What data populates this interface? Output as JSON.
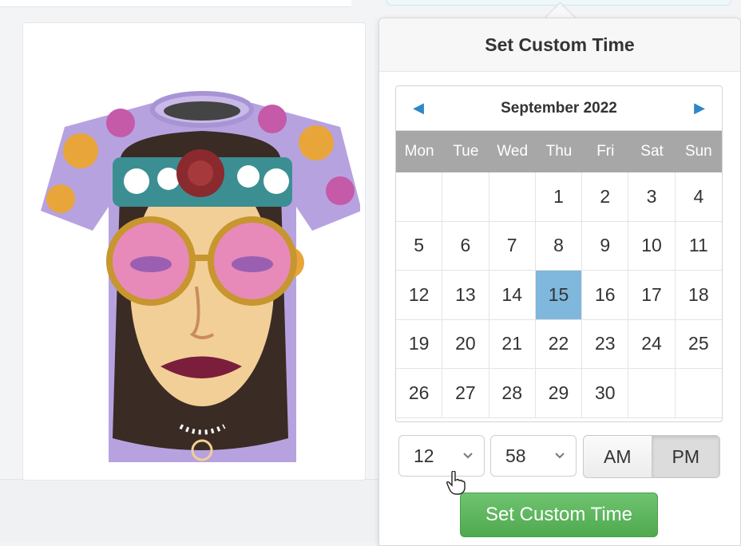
{
  "popover": {
    "title": "Set Custom Time"
  },
  "calendar": {
    "month_label": "September 2022",
    "prev_icon": "chevron-left-icon",
    "next_icon": "chevron-right-icon",
    "weekdays": [
      "Mon",
      "Tue",
      "Wed",
      "Thu",
      "Fri",
      "Sat",
      "Sun"
    ],
    "days": [
      "",
      "",
      "",
      "1",
      "2",
      "3",
      "4",
      "5",
      "6",
      "7",
      "8",
      "9",
      "10",
      "11",
      "12",
      "13",
      "14",
      "15",
      "16",
      "17",
      "18",
      "19",
      "20",
      "21",
      "22",
      "23",
      "24",
      "25",
      "26",
      "27",
      "28",
      "29",
      "30",
      "",
      ""
    ],
    "selected_day": "15",
    "selected_color": "#7fb7dd",
    "nav_color": "#2f86c9"
  },
  "time": {
    "hour": "12",
    "minute": "58",
    "am_label": "AM",
    "pm_label": "PM",
    "selected_period": "PM"
  },
  "actions": {
    "set_label": "Set Custom Time",
    "set_color": "#5cb85c"
  },
  "product": {
    "image_icon": "tshirt-product-image"
  }
}
